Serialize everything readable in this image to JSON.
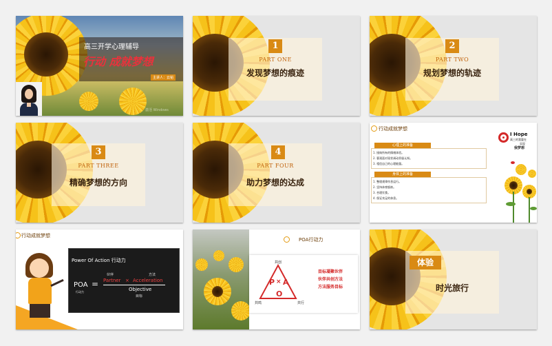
{
  "slide1": {
    "course": "高三开学心理辅导",
    "title": "行动 成就梦想",
    "speaker": "主讲人：云韬",
    "watermark": "激活 Windows"
  },
  "slide2": {
    "number": "1",
    "part": "PART ONE",
    "subtitle": "发现梦想的痕迹"
  },
  "slide3": {
    "number": "2",
    "part": "PART TWO",
    "subtitle": "规划梦想的轨迹"
  },
  "slide4": {
    "number": "3",
    "part": "PART THREE",
    "subtitle": "精确梦想的方向"
  },
  "slide5": {
    "number": "4",
    "part": "PART FOUR",
    "subtitle": "助力梦想的达成"
  },
  "slide6": {
    "header": "行动成就梦想",
    "section1": {
      "title": "心理上的准备",
      "items": [
        "1. 接纳所有的情绪体验。",
        "2. 客观面对现状调动积极认知。",
        "3. 相信自己的心理能量。"
      ]
    },
    "section2": {
      "title": "身体上的准备",
      "items": [
        "1. 整理规律作息运行。",
        "2. 坚持体育锻炼。",
        "3. 合理饮食。",
        "4. 保证充足的休息。"
      ]
    },
    "badge": {
      "line1": "I Hope",
      "line2": "高三的我要在",
      "line3": "实现",
      "line4": "我梦想"
    }
  },
  "slide7": {
    "header": "行动成就梦想",
    "board": {
      "title": "Power Of Action 行动力",
      "poa": "POA",
      "poa_sub": "行动力",
      "eq": "=",
      "partner_cn": "伙伴",
      "method_cn": "方法",
      "partner": "Partner",
      "times": "×",
      "acceleration": "Acceleration",
      "objective": "Objective",
      "objective_cn": "目标"
    }
  },
  "slide8": {
    "title": "POA行动力",
    "diagram": {
      "top": "共创",
      "left": "共鸣",
      "right": "共行",
      "p": "P",
      "x": "×",
      "a": "A",
      "o": "O"
    },
    "lines": [
      "目标凝聚伙伴",
      "伙伴共创方法",
      "方法服务目标"
    ]
  },
  "slide9": {
    "tag": "体验",
    "subtitle": "时光旅行"
  },
  "colors": {
    "accent": "#d98a14",
    "title_red": "#e8323c",
    "red": "#d42a2a"
  }
}
